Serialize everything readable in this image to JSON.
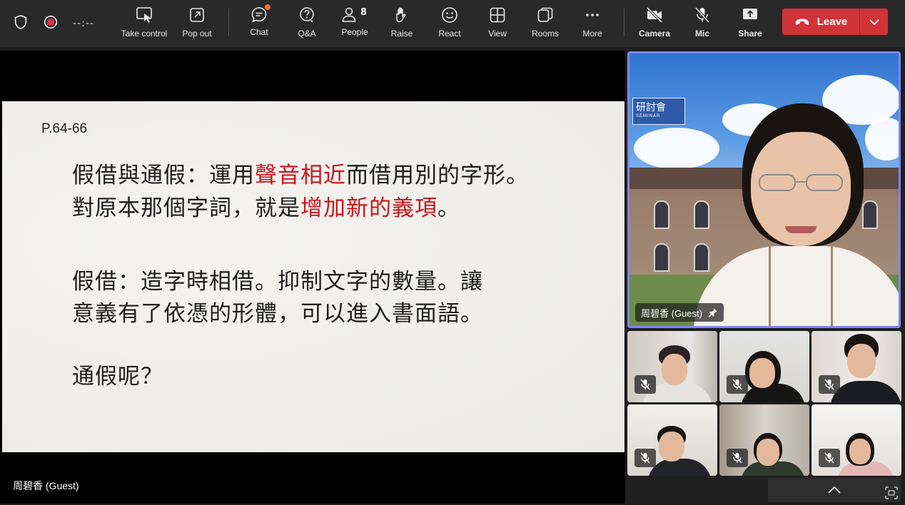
{
  "toolbar": {
    "timer": "--:--",
    "take_control": "Take control",
    "pop_out": "Pop out",
    "chat": "Chat",
    "qa": "Q&A",
    "people": "People",
    "people_count": "8",
    "raise": "Raise",
    "react": "React",
    "view": "View",
    "rooms": "Rooms",
    "more": "More",
    "camera": "Camera",
    "mic": "Mic",
    "share": "Share",
    "leave": "Leave"
  },
  "colors": {
    "toolbar_bg": "#292929",
    "leave_red": "#d13438",
    "active_speaker_border": "#7f85f5",
    "slide_highlight": "#c9151e",
    "chat_notification": "#ff6a3d"
  },
  "icons": {
    "shield": "shield-icon",
    "record": "record-icon",
    "take_control": "take-control-icon",
    "pop_out": "pop-out-icon",
    "chat": "chat-icon",
    "qa": "qa-icon",
    "people": "people-icon",
    "raise": "hand-icon",
    "react": "smiley-icon",
    "view": "grid-icon",
    "rooms": "rooms-icon",
    "more": "more-icon",
    "camera_off": "camera-off-icon",
    "mic_off": "mic-off-icon",
    "share": "share-icon",
    "phone": "phone-icon"
  },
  "slide": {
    "page_ref": "P.64-66",
    "line1_a": "假借與通假：運用",
    "line1_hl": "聲音相近",
    "line1_b": "而借用別的字形。",
    "line2_a": "對原本那個字詞，就是",
    "line2_hl": "增加新的義項",
    "line2_b": "。",
    "line3": "假借：造字時相借。抑制文字的數量。讓",
    "line4": "意義有了依憑的形體，可以進入書面語。",
    "line5": "通假呢？"
  },
  "stage": {
    "presenter_name": "周碧香 (Guest)"
  },
  "featured": {
    "name": "周碧香 (Guest)",
    "banner_text": "研討會",
    "banner_sub": "SEMINAR"
  },
  "gallery": {
    "tile_count": 6
  }
}
